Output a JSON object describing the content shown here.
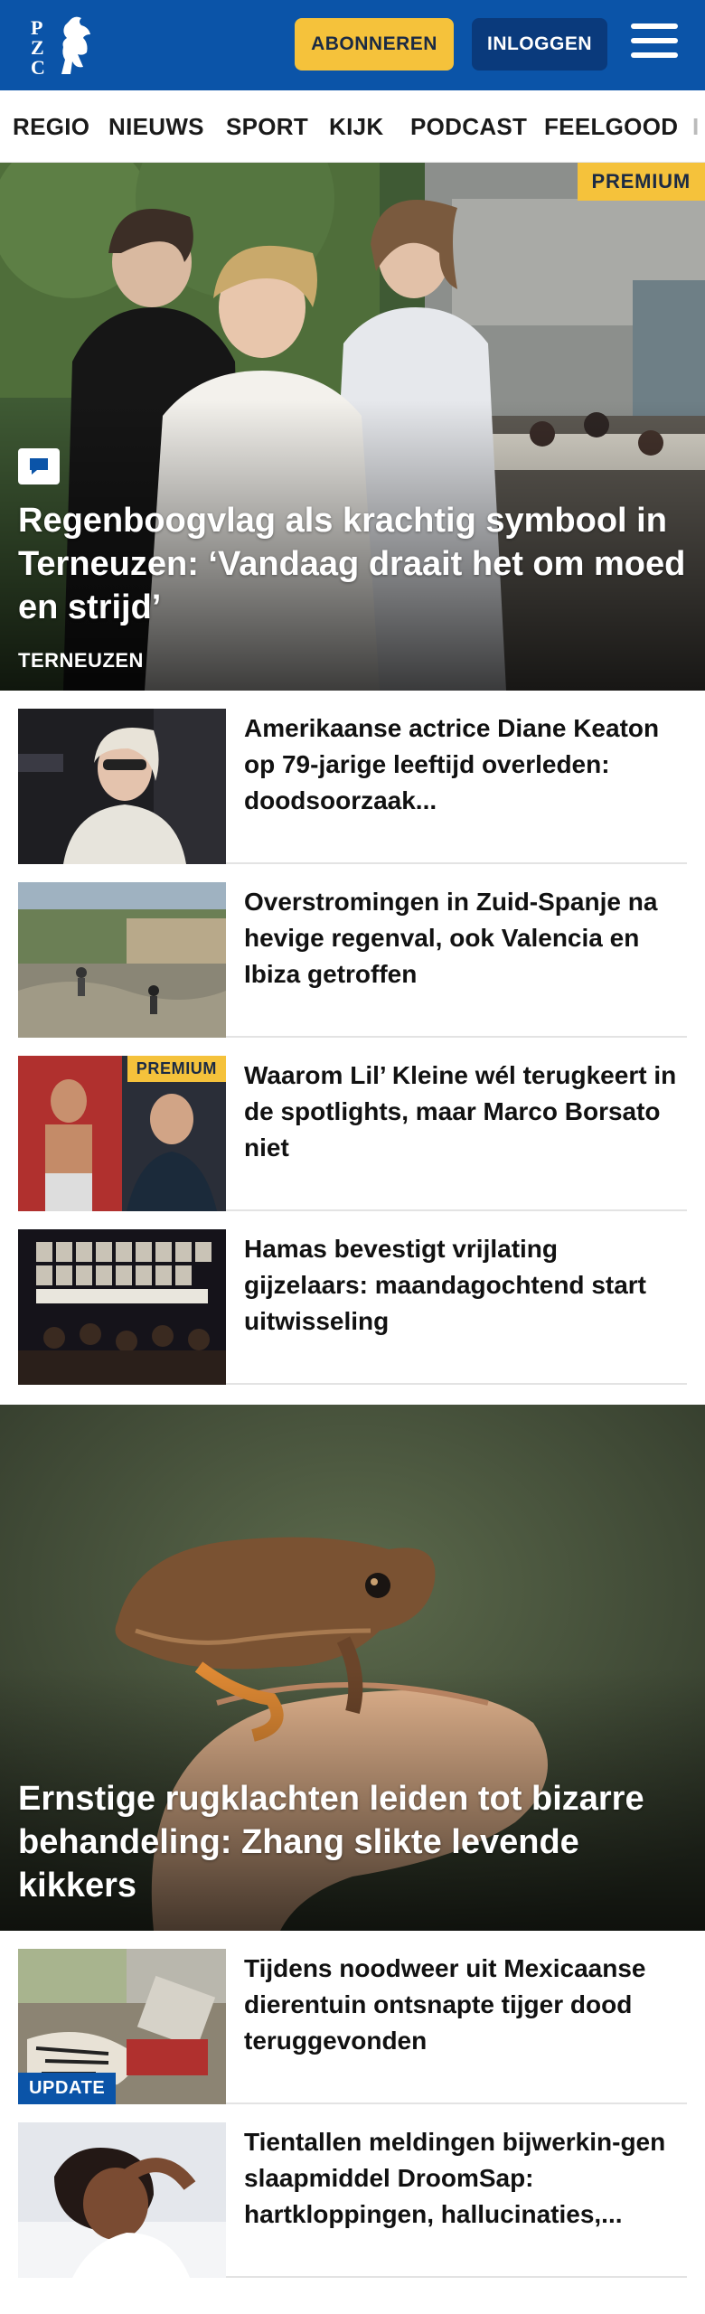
{
  "header": {
    "logo_letters": [
      "P",
      "Z",
      "C"
    ],
    "subscribe_label": "ABONNEREN",
    "login_label": "INLOGGEN",
    "brand_color": "#0b54a8",
    "accent_color": "#f5c23b"
  },
  "nav": {
    "items": [
      "REGIO",
      "NIEUWS",
      "SPORT",
      "KIJK",
      "PODCAST",
      "FEELGOOD",
      "I"
    ]
  },
  "hero1": {
    "badge": "PREMIUM",
    "icon": "comment-icon",
    "title": "Regenboogvlag als krachtig symbool in Terneuzen: ‘Vandaag draait het om moed en strijd’",
    "kicker": "TERNEUZEN"
  },
  "list1": [
    {
      "title": "Amerikaanse actrice Diane Keaton op 79-jarige leeftijd overleden: doodsoorzaak...",
      "badge": ""
    },
    {
      "title": "Overstromingen in Zuid-Spanje na hevige regenval, ook Valencia en Ibiza getroffen",
      "badge": ""
    },
    {
      "title": "Waarom Lil’ Kleine wél terugkeert in de spotlights, maar Marco Borsato niet",
      "badge": "PREMIUM"
    },
    {
      "title": "Hamas bevestigt vrijlating gijzelaars: maandagochtend start uitwisseling",
      "badge": ""
    }
  ],
  "hero2": {
    "title": "Ernstige rugklachten leiden tot bizarre behandeling: Zhang slikte levende kikkers"
  },
  "list2": [
    {
      "title": "Tijdens noodweer uit Mexicaanse dierentuin ontsnapte tijger dood teruggevonden",
      "badge": "UPDATE"
    },
    {
      "title": "Tientallen meldingen bijwerkin-gen slaapmiddel DroomSap: hartkloppingen, hallucinaties,...",
      "badge": ""
    }
  ]
}
